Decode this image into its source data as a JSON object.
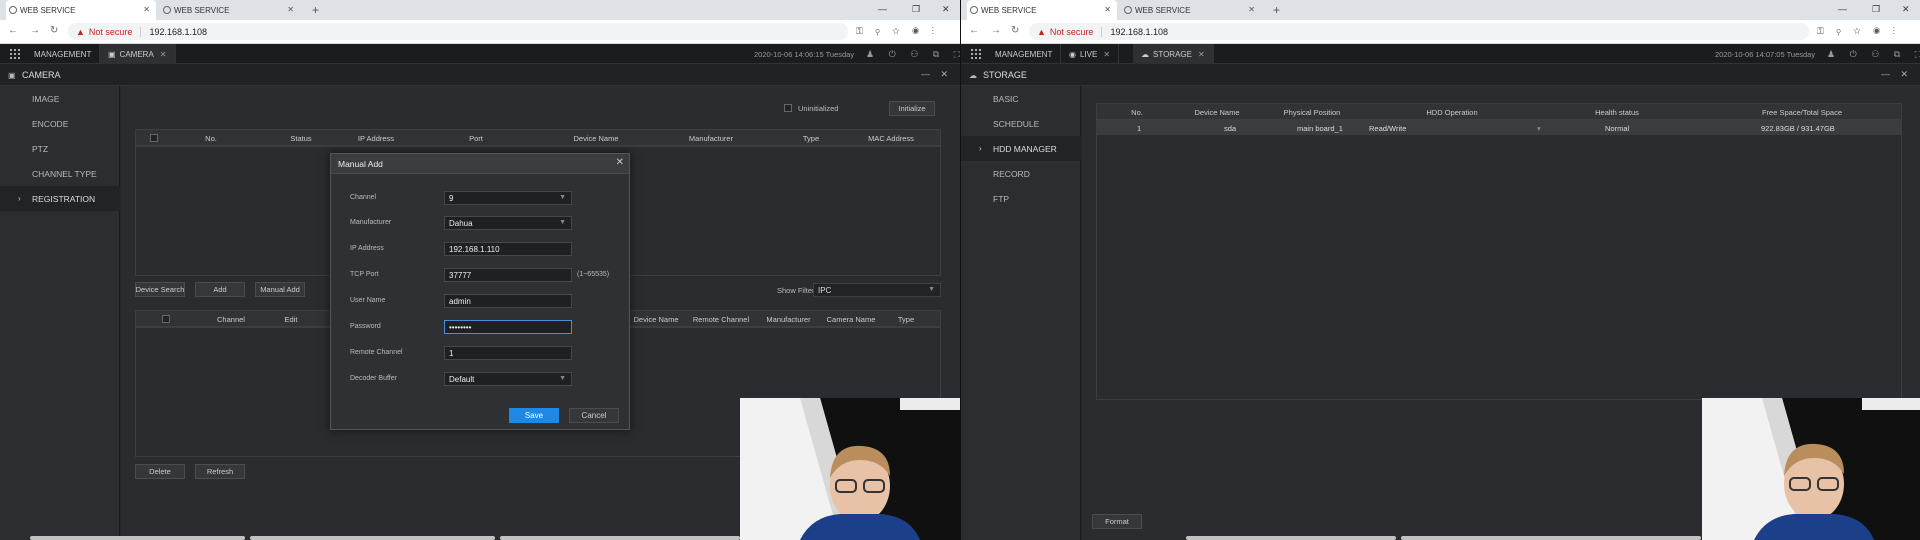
{
  "left": {
    "browser": {
      "tabs": [
        {
          "title": "WEB SERVICE"
        },
        {
          "title": "WEB SERVICE"
        }
      ],
      "warning": "Not secure",
      "url": "192.168.1.108"
    },
    "app": {
      "menu_label": "MANAGEMENT",
      "tab_label": "CAMERA",
      "datetime": "2020-10-06 14:06:15 Tuesday"
    },
    "module_title": "CAMERA",
    "sidebar": [
      "IMAGE",
      "ENCODE",
      "PTZ",
      "CHANNEL TYPE",
      "REGISTRATION"
    ],
    "top": {
      "uninitialized": "Uninitialized",
      "initialize_btn": "Initialize",
      "columns": [
        "No.",
        "Status",
        "IP Address",
        "Port",
        "Device Name",
        "Manufacturer",
        "Type",
        "MAC Address"
      ]
    },
    "buttons": {
      "device_search": "Device Search",
      "add": "Add",
      "manual_add": "Manual Add",
      "delete": "Delete",
      "refresh": "Refresh"
    },
    "filter": {
      "label": "Show Filter",
      "value": "IPC"
    },
    "bottom": {
      "columns_left": [
        "Channel",
        "Edit"
      ],
      "columns_right": [
        "Device Name",
        "Remote Channel",
        "Manufacturer",
        "Camera Name",
        "Type"
      ]
    },
    "modal": {
      "title": "Manual Add",
      "labels": {
        "channel": "Channel",
        "manufacturer": "Manufacturer",
        "ip": "IP Address",
        "tcp": "TCP Port",
        "user": "User Name",
        "password": "Password",
        "remote": "Remote Channel",
        "decoder": "Decoder Buffer"
      },
      "values": {
        "channel": "9",
        "manufacturer": "Dahua",
        "ip": "192.168.1.110",
        "tcp": "37777",
        "user": "admin",
        "password": "••••••••",
        "remote": "1",
        "decoder": "Default"
      },
      "tcp_hint": "(1~65535)",
      "save": "Save",
      "cancel": "Cancel"
    }
  },
  "right": {
    "browser": {
      "tabs": [
        {
          "title": "WEB SERVICE"
        },
        {
          "title": "WEB SERVICE"
        }
      ],
      "warning": "Not secure",
      "url": "192.168.1.108"
    },
    "app": {
      "menu_label": "MANAGEMENT",
      "tabs": [
        "LIVE",
        "STORAGE"
      ],
      "datetime": "2020-10-06 14:07:05 Tuesday"
    },
    "module_title": "STORAGE",
    "sidebar": [
      "BASIC",
      "SCHEDULE",
      "HDD MANAGER",
      "RECORD",
      "FTP"
    ],
    "table": {
      "columns": [
        "No.",
        "Device Name",
        "Physical Position",
        "HDD Operation",
        "Health status",
        "Free Space/Total Space"
      ],
      "rows": [
        {
          "no": "1",
          "device": "sda",
          "position": "main board_1",
          "operation": "Read/Write",
          "health": "Normal",
          "space": "922.83GB / 931.47GB"
        }
      ]
    },
    "format_btn": "Format"
  }
}
